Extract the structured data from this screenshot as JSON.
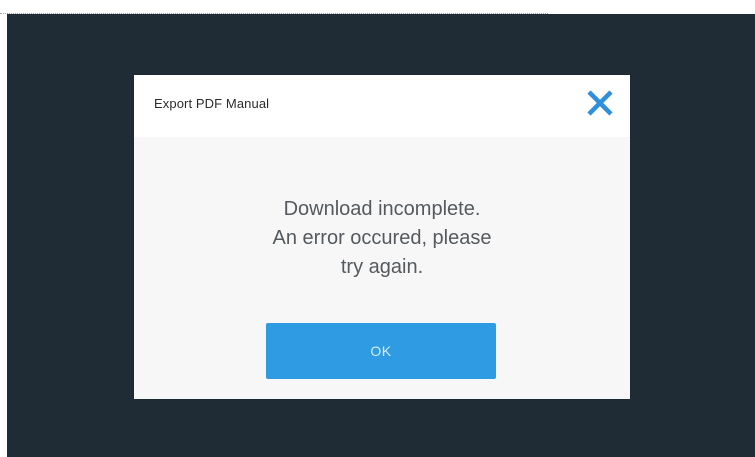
{
  "dialog": {
    "title": "Export PDF Manual",
    "close_icon": "close-icon",
    "message_line1": "Download incomplete.",
    "message_line2": "An error occured, please",
    "message_line3": "try again.",
    "ok_label": "OK"
  },
  "colors": {
    "backdrop": "#1f2b35",
    "accent": "#2f9be3",
    "close_icon": "#2f8fdc",
    "body_bg": "#f7f7f7"
  }
}
